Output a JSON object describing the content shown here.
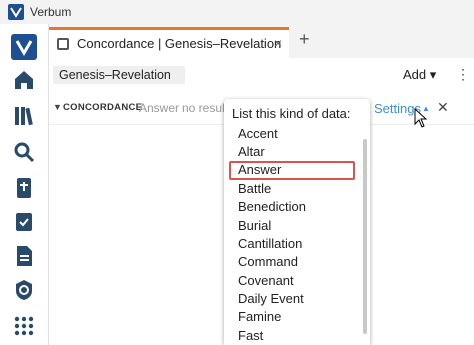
{
  "app": {
    "title": "Verbum"
  },
  "tab": {
    "label": "Concordance | Genesis–Revelation",
    "close": "×",
    "add": "+"
  },
  "toolbar": {
    "range": "Genesis–Revelation",
    "add_label": "Add ▾",
    "more": "⋮"
  },
  "concordance": {
    "caret": "▼",
    "label": "CONCORDANCE",
    "field": "Answer",
    "note": "no result",
    "settings_label": "Settings",
    "settings_arrow": "▲",
    "close": "✕"
  },
  "dropdown": {
    "title": "List this kind of data:",
    "selected": "Answer",
    "items": [
      "Accent",
      "Altar",
      "Answer",
      "Battle",
      "Benediction",
      "Burial",
      "Cantillation",
      "Command",
      "Covenant",
      "Daily Event",
      "Famine",
      "Fast"
    ]
  },
  "sidebar": {
    "icons": [
      "verbum-logo-icon",
      "home-icon",
      "library-icon",
      "search-icon",
      "bible-icon",
      "checklist-icon",
      "document-icon",
      "badge-icon",
      "apps-grid-icon"
    ]
  }
}
